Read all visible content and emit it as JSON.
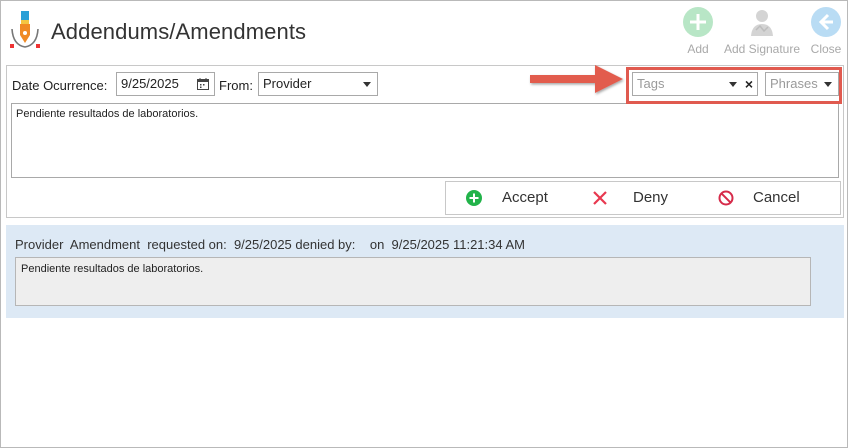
{
  "header": {
    "title": "Addendums/Amendments"
  },
  "toolbar": {
    "add_label": "Add",
    "add_signature_label": "Add Signature",
    "close_label": "Close"
  },
  "form": {
    "date_label": "Date Ocurrence:",
    "date_value": "9/25/2025",
    "from_label": "From:",
    "from_value": "Provider",
    "tags_placeholder": "Tags",
    "phrases_placeholder": "Phrases",
    "note_text": "Pendiente resultados de laboratorios."
  },
  "actions": {
    "accept_label": "Accept",
    "deny_label": "Deny",
    "cancel_label": "Cancel"
  },
  "history": {
    "summary": "Provider  Amendment  requested on:  9/25/2025 denied by:    on  9/25/2025 11:21:34 AM",
    "note_text": "Pendiente resultados de laboratorios."
  },
  "colors": {
    "highlight": "#e05a4f",
    "accept": "#22b34a",
    "deny": "#e8384f",
    "cancel": "#d62b4a",
    "entry_background": "#dde9f5"
  },
  "icons": {
    "app": "pen-nib-icon",
    "add": "plus-circle-icon",
    "add_signature": "person-signature-icon",
    "close": "arrow-left-circle-icon",
    "calendar": "calendar-icon",
    "accept": "plus-circle-icon",
    "deny": "x-icon",
    "cancel": "no-entry-icon"
  }
}
